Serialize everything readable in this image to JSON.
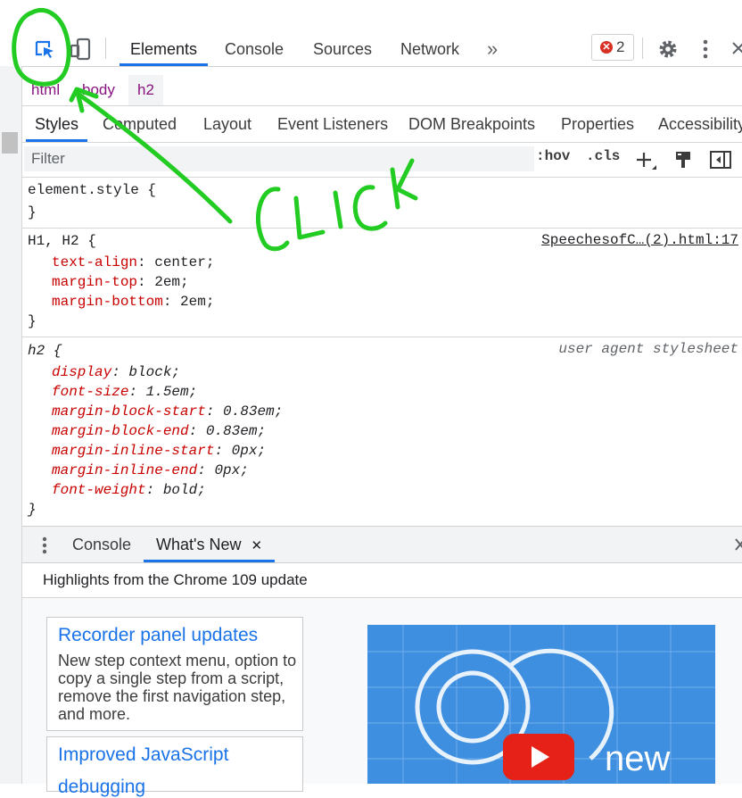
{
  "toolbar": {
    "tabs": [
      {
        "label": "Elements",
        "active": true
      },
      {
        "label": "Console",
        "active": false
      },
      {
        "label": "Sources",
        "active": false
      },
      {
        "label": "Network",
        "active": false
      }
    ],
    "more_tabs_glyph": "»",
    "error_count": "2",
    "icons": [
      "inspect-element-icon",
      "device-toolbar-icon",
      "error-icon",
      "gear-icon",
      "kebab-menu-icon",
      "close-icon"
    ]
  },
  "breadcrumbs": [
    {
      "label": "html",
      "active": false
    },
    {
      "label": "body",
      "active": false
    },
    {
      "label": "h2",
      "active": true
    }
  ],
  "subtabs": [
    {
      "label": "Styles",
      "active": true
    },
    {
      "label": "Computed",
      "active": false
    },
    {
      "label": "Layout",
      "active": false
    },
    {
      "label": "Event Listeners",
      "active": false
    },
    {
      "label": "DOM Breakpoints",
      "active": false
    },
    {
      "label": "Properties",
      "active": false
    },
    {
      "label": "Accessibility",
      "active": false
    }
  ],
  "filter": {
    "placeholder": "Filter",
    "hov_label": ":hov",
    "cls_label": ".cls"
  },
  "rules": {
    "element_style": {
      "selector": "element.style {",
      "close": "}"
    },
    "h1h2": {
      "selector": "H1, H2 {",
      "source": "SpeechesofC…(2).html:17",
      "props": [
        {
          "name": "text-align",
          "value": "center;"
        },
        {
          "name": "margin-top",
          "value": "2em;"
        },
        {
          "name": "margin-bottom",
          "value": "2em;"
        }
      ],
      "close": "}"
    },
    "h2": {
      "selector": "h2 {",
      "source": "user agent stylesheet",
      "props": [
        {
          "name": "display",
          "value": "block;"
        },
        {
          "name": "font-size",
          "value": "1.5em;"
        },
        {
          "name": "margin-block-start",
          "value": "0.83em;"
        },
        {
          "name": "margin-block-end",
          "value": "0.83em;"
        },
        {
          "name": "margin-inline-start",
          "value": "0px;"
        },
        {
          "name": "margin-inline-end",
          "value": "0px;"
        },
        {
          "name": "font-weight",
          "value": "bold;"
        }
      ],
      "close": "}"
    }
  },
  "drawer": {
    "tabs": [
      {
        "label": "Console",
        "active": false
      },
      {
        "label": "What's New",
        "active": true
      }
    ],
    "close_glyph": "✕",
    "highlights": "Highlights from the Chrome 109 update"
  },
  "whats_new": {
    "cards": [
      {
        "title": "Recorder panel updates",
        "description": "New step context menu, option to copy a single step from a script, remove the first navigation step, and more."
      },
      {
        "title": "Improved JavaScript",
        "description": ""
      }
    ],
    "video_label": "new"
  },
  "annotation": {
    "text": "CLICK",
    "color": "#22cc22"
  },
  "colors": {
    "accent": "#1a73e8",
    "tag": "#881280",
    "css_property": "#c80000",
    "error": "#d93025"
  }
}
